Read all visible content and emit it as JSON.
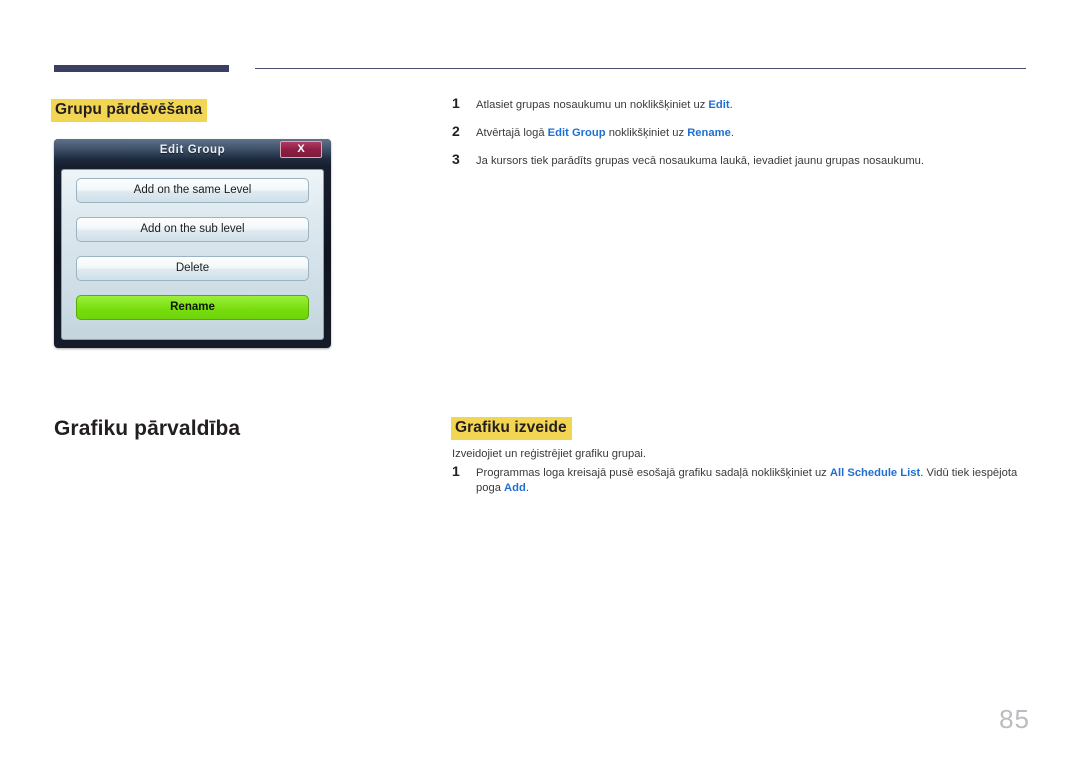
{
  "header": {
    "rule_left_color": "#3b3f63",
    "rule_right_color": "#4a4e70"
  },
  "highlight_color": "#f2d552",
  "link_color": "#1f6fd0",
  "sections": {
    "rename_group": {
      "heading": "Grupu pārdēvēšana",
      "steps": [
        {
          "number": "1",
          "html": "Atlasiet grupas nosaukumu un noklikšķiniet uz <b>Edit</b>."
        },
        {
          "number": "2",
          "html": "Atvērtajā logā <b>Edit Group</b> noklikšķiniet uz <b>Rename</b>."
        },
        {
          "number": "3",
          "html": "Ja kursors tiek parādīts grupas vecā nosaukuma laukā, ievadiet jaunu grupas nosaukumu."
        }
      ]
    },
    "schedule_management": {
      "title": "Grafiku pārvaldība"
    },
    "create_schedule": {
      "heading": "Grafiku izveide",
      "lead": "Izveidojiet un reģistrējiet grafiku grupai.",
      "steps": [
        {
          "number": "1",
          "html": "Programmas loga kreisajā pusē esošajā grafiku sadaļā noklikšķiniet uz <b>All Schedule List</b>. Vidū tiek iespējota poga <b>Add</b>."
        }
      ]
    }
  },
  "edit_group_dialog": {
    "title": "Edit Group",
    "close_label": "X",
    "close_color": "#8e1f45",
    "buttons": [
      {
        "label": "Add on the same Level",
        "primary": false
      },
      {
        "label": "Add on the sub level",
        "primary": false
      },
      {
        "label": "Delete",
        "primary": false
      },
      {
        "label": "Rename",
        "primary": true
      }
    ],
    "primary_button_color": "#7CE016"
  },
  "page_number": "85"
}
